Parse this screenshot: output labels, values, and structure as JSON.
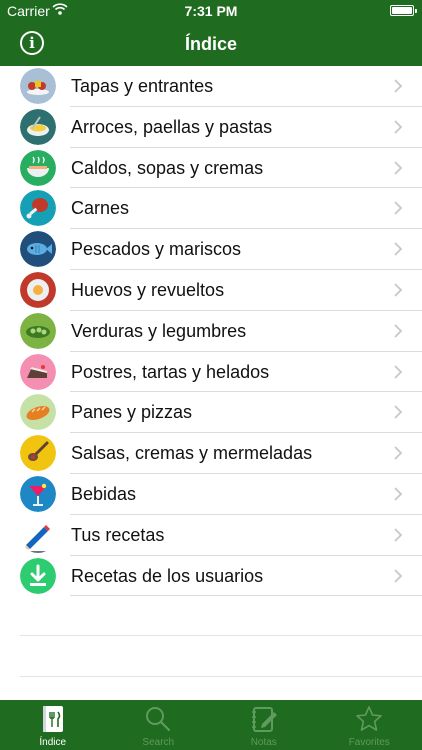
{
  "status_bar": {
    "carrier": "Carrier",
    "time": "7:31 PM"
  },
  "nav": {
    "title": "Índice",
    "info_icon": "info-icon"
  },
  "categories": [
    {
      "label": "Tapas y entrantes",
      "icon": "tapas-icon"
    },
    {
      "label": "Arroces, paellas y pastas",
      "icon": "paella-icon"
    },
    {
      "label": "Caldos, sopas y cremas",
      "icon": "soup-icon"
    },
    {
      "label": "Carnes",
      "icon": "meat-icon"
    },
    {
      "label": "Pescados y mariscos",
      "icon": "fish-icon"
    },
    {
      "label": "Huevos y revueltos",
      "icon": "egg-icon"
    },
    {
      "label": "Verduras y legumbres",
      "icon": "vegetables-icon"
    },
    {
      "label": "Postres, tartas y helados",
      "icon": "cake-icon"
    },
    {
      "label": "Panes y pizzas",
      "icon": "bread-icon"
    },
    {
      "label": "Salsas, cremas y mermeladas",
      "icon": "sauce-icon"
    },
    {
      "label": "Bebidas",
      "icon": "cocktail-icon"
    },
    {
      "label": "Tus recetas",
      "icon": "pencil-icon"
    },
    {
      "label": "Recetas de los usuarios",
      "icon": "download-icon"
    }
  ],
  "tabs": [
    {
      "label": "Índice",
      "icon": "recipe-book-icon",
      "active": true
    },
    {
      "label": "Search",
      "icon": "search-icon",
      "active": false
    },
    {
      "label": "Notas",
      "icon": "notes-icon",
      "active": false
    },
    {
      "label": "Favorites",
      "icon": "star-icon",
      "active": false
    }
  ],
  "colors": {
    "header": "#1f6b1f",
    "tabbar": "#1f6b1f",
    "inactive_tab": "#5f9a5f",
    "separator": "#dcdcdc"
  }
}
